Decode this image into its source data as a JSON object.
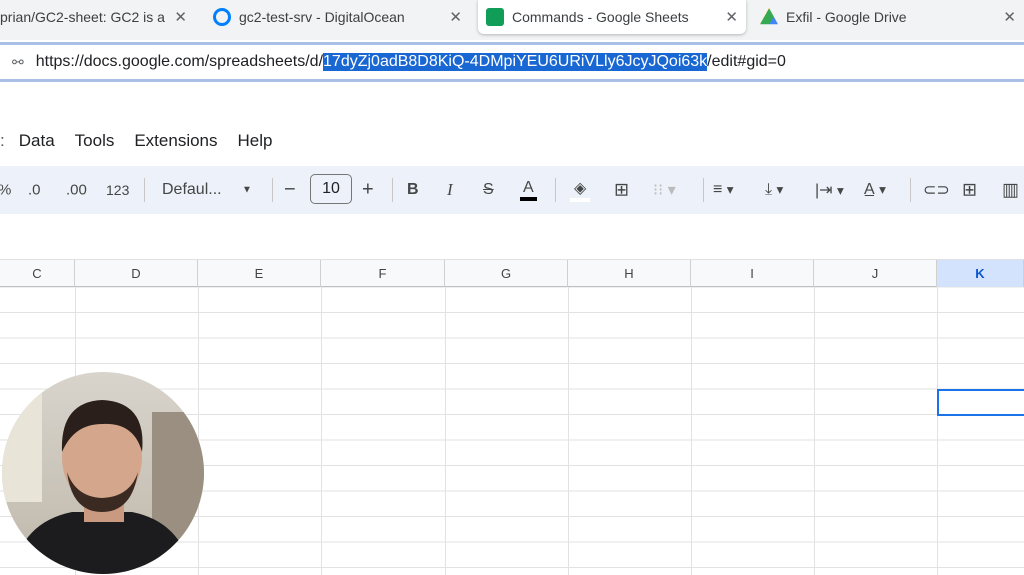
{
  "tabs": [
    {
      "title": "prian/GC2-sheet: GC2 is a",
      "active": false
    },
    {
      "title": "gc2-test-srv - DigitalOcean",
      "active": false
    },
    {
      "title": "Commands - Google Sheets",
      "active": true
    },
    {
      "title": "Exfil - Google Drive",
      "active": false
    }
  ],
  "address": {
    "prefix": "https://docs.google.com/spreadsheets/d/",
    "selected": "17dyZj0adB8D8KiQ-4DMpiYEU6URiVLly6JcyJQoi63k",
    "suffix": "/edit#gid=0"
  },
  "menu": [
    "Data",
    "Tools",
    "Extensions",
    "Help"
  ],
  "toolbar": {
    "percent": "%",
    "dec_decrease": ".0",
    "dec_increase": ".00",
    "format_123": "123",
    "font": "Defaul...",
    "font_size": "10",
    "minus": "−",
    "plus": "+",
    "bold": "B",
    "italic": "I",
    "strike": "S",
    "text_color": "A"
  },
  "columns": [
    "C",
    "D",
    "E",
    "F",
    "G",
    "H",
    "I",
    "J",
    "K"
  ],
  "colors": {
    "accent": "#1a73e8",
    "toolbar": "#edf2fa"
  }
}
